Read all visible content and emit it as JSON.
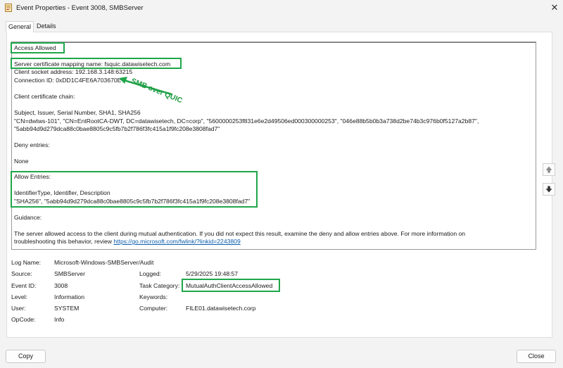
{
  "window": {
    "title": "Event Properties - Event 3008, SMBServer"
  },
  "tabs": [
    {
      "label": "General"
    },
    {
      "label": "Details"
    }
  ],
  "message": {
    "lines": [
      "Access Allowed",
      "Server certificate mapping name: fsquic.datawisetech.com",
      "Client socket address: 192.168.3.148:63215",
      "Connection ID: 0xDD1C4FE6A703670E",
      "Client certificate chain:",
      "Subject, Issuer, Serial Number, SHA1, SHA256",
      "\"CN=dwtws-101\", \"CN=EntRootCA-DWT, DC=datawisetech, DC=corp\", \"5600000253f831e6e2d49506ed000300000253\", \"046e88b5b0b3a738d2be74b3c976b0f5127a2b87\",",
      "\"5abb94d9d279dca88c0bae8805c9c5fb7b2f786f3fc415a1f9fc208e3808fad7\"",
      "Deny entries:",
      "None",
      "Allow Entries:",
      "IdentifierType, Identifier, Description",
      "\"SHA256\", \"5abb94d9d279dca88c0bae8805c9c5fb7b2f786f3fc415a1f9fc208e3808fad7\"",
      "Guidance:",
      "The server allowed access to the client during mutual authentication. If you did not expect this result, examine the deny and allow entries above. For more information on",
      "troubleshooting this behavior, review "
    ],
    "link": "https://go.microsoft.com/fwlink/?linkid=2243809"
  },
  "annotation": {
    "text": "SMB over QUIC",
    "color": "#1fa64a"
  },
  "details": {
    "log_name_label": "Log Name:",
    "log_name": "Microsoft-Windows-SMBServer/Audit",
    "source_label": "Source:",
    "source": "SMBServer",
    "logged_label": "Logged:",
    "logged": "5/29/2025 19:48:57",
    "event_id_label": "Event ID:",
    "event_id": "3008",
    "task_category_label": "Task Category:",
    "task_category": "MutualAuthClientAccessAllowed",
    "level_label": "Level:",
    "level": "Information",
    "keywords_label": "Keywords:",
    "keywords": "",
    "user_label": "User:",
    "user": "SYSTEM",
    "computer_label": "Computer:",
    "computer": "FILE01.datawisetech.corp",
    "opcode_label": "OpCode:",
    "opcode": "Info"
  },
  "buttons": {
    "copy": "Copy",
    "close": "Close"
  },
  "icons": {
    "app": "event-viewer-icon",
    "close": "close-icon",
    "scroll_up": "arrow-up-icon",
    "scroll_down": "arrow-down-icon"
  }
}
